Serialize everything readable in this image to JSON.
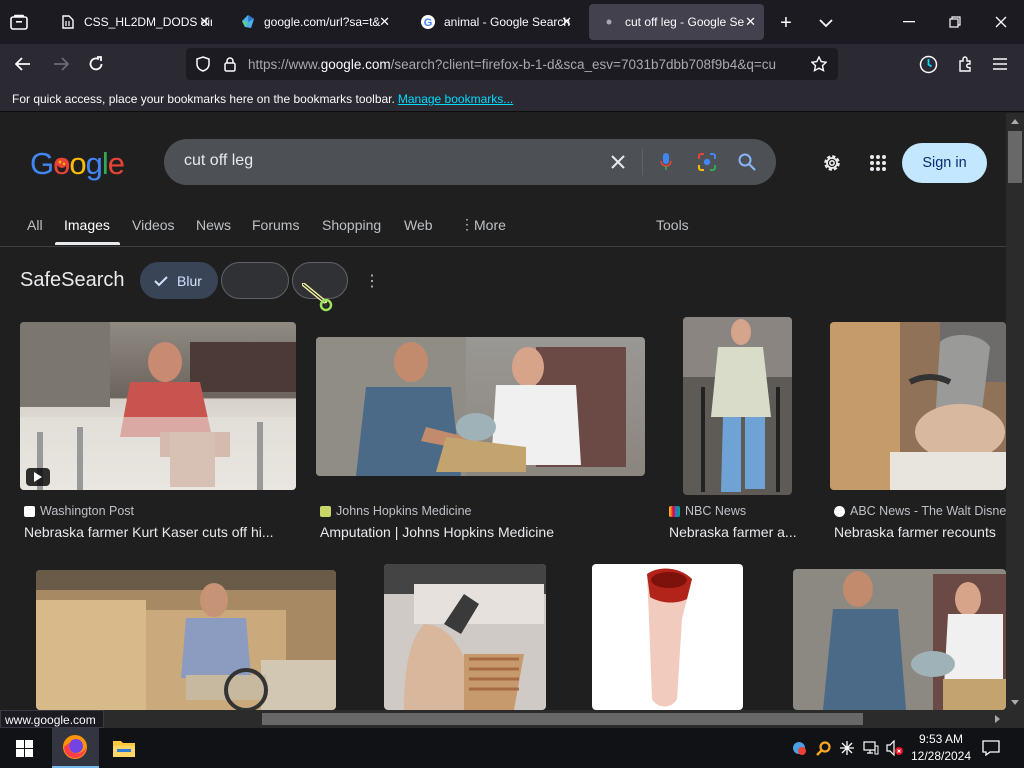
{
  "browser": {
    "tabs": [
      {
        "title": "CSS_HL2DM_DODS dir",
        "favicon": "file-icon",
        "selected": false
      },
      {
        "title": "google.com/url?sa=t&",
        "favicon": "globe-icon",
        "selected": false
      },
      {
        "title": "animal - Google Search",
        "favicon": "google-icon",
        "selected": false
      },
      {
        "title": "cut off leg - Google Se",
        "favicon": "dot-icon",
        "selected": true
      }
    ],
    "url_prefix": "https://www.",
    "url_domain": "google.com",
    "url_rest": "/search?client=firefox-b-1-d&sca_esv=7031b7dbb708f9b4&q=cu",
    "bookmarks_hint": "For quick access, place your bookmarks here on the bookmarks toolbar.",
    "manage_bookmarks": "Manage bookmarks..."
  },
  "search": {
    "query": "cut off leg",
    "sign_in": "Sign in",
    "tabs": [
      "All",
      "Images",
      "Videos",
      "News",
      "Forums",
      "Shopping",
      "Web",
      "More",
      "Tools"
    ],
    "active_tab": "Images",
    "safesearch_label": "SafeSearch",
    "blur_label": "Blur"
  },
  "results": [
    {
      "source": "Washington Post",
      "title": "Nebraska farmer Kurt Kaser cuts off hi...",
      "has_video": true
    },
    {
      "source": "Johns Hopkins Medicine",
      "title": "Amputation | Johns Hopkins Medicine"
    },
    {
      "source": "NBC News",
      "title": "Nebraska farmer a..."
    },
    {
      "source": "ABC News - The Walt Disne",
      "title": "Nebraska farmer recounts"
    }
  ],
  "status_url": "www.google.com",
  "taskbar": {
    "time": "9:53 AM",
    "date": "12/28/2024"
  },
  "colors": {
    "accent_link": "#00ddff",
    "sign_in_bg": "#c2e7ff",
    "chip_selected": "#394457"
  }
}
